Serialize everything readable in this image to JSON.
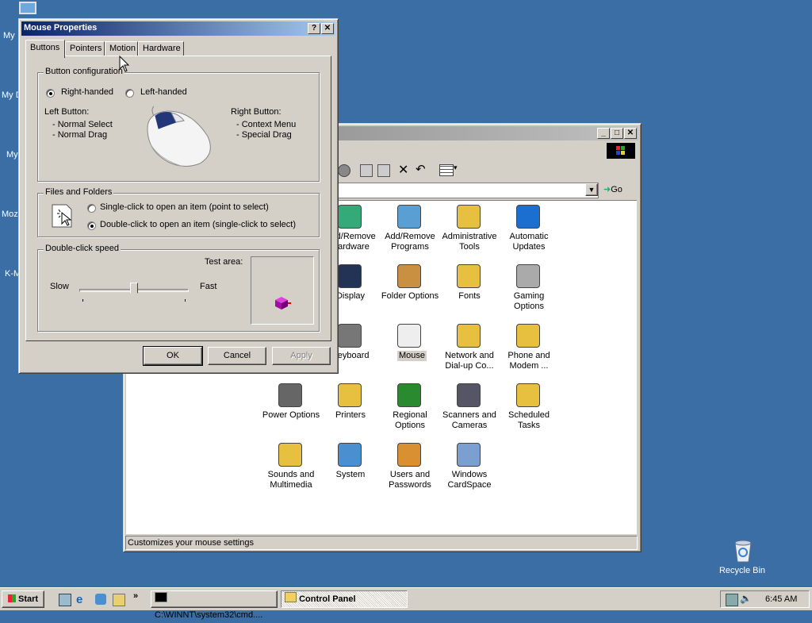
{
  "desktop": {
    "left_labels": [
      "My",
      "My D",
      "My",
      "Moz",
      "K-M"
    ],
    "recycle_bin": "Recycle Bin"
  },
  "mouse_dialog": {
    "title": "Mouse Properties",
    "help_btn": "?",
    "close_btn": "✕",
    "tabs": [
      "Buttons",
      "Pointers",
      "Motion",
      "Hardware"
    ],
    "active_tab": "Buttons",
    "button_config": {
      "legend": "Button configuration",
      "right_handed": "Right-handed",
      "left_handed": "Left-handed",
      "selected": "Right-handed",
      "left_button_title": "Left Button:",
      "left_button_items": [
        "- Normal Select",
        "- Normal Drag"
      ],
      "right_button_title": "Right Button:",
      "right_button_items": [
        "- Context Menu",
        "- Special Drag"
      ]
    },
    "files_folders": {
      "legend": "Files and Folders",
      "single_click": "Single-click to open an item (point to select)",
      "double_click": "Double-click to open an item (single-click to select)",
      "selected": "double"
    },
    "double_click_speed": {
      "legend": "Double-click speed",
      "test_area": "Test area:",
      "slow": "Slow",
      "fast": "Fast",
      "slider_value": 0.5
    },
    "buttons": {
      "ok": "OK",
      "cancel": "Cancel",
      "apply": "Apply"
    }
  },
  "control_panel": {
    "title": "Control Panel",
    "go_label": "Go",
    "status": "Customizes your mouse settings",
    "icons": [
      {
        "label": "Add/Remove\nHardware",
        "icon": "hardware-icon"
      },
      {
        "label": "Add/Remove\nPrograms",
        "icon": "programs-icon"
      },
      {
        "label": "Administrative\nTools",
        "icon": "admin-tools-icon"
      },
      {
        "label": "Automatic\nUpdates",
        "icon": "updates-icon"
      },
      {
        "label": "Display",
        "icon": "display-icon"
      },
      {
        "label": "Folder Options",
        "icon": "folder-options-icon"
      },
      {
        "label": "Fonts",
        "icon": "fonts-icon"
      },
      {
        "label": "Gaming\nOptions",
        "icon": "gaming-icon"
      },
      {
        "label": "Keyboard",
        "icon": "keyboard-icon"
      },
      {
        "label": "Mouse",
        "icon": "mouse-icon"
      },
      {
        "label": "Network and\nDial-up Co...",
        "icon": "network-icon"
      },
      {
        "label": "Phone and\nModem ...",
        "icon": "phone-icon"
      },
      {
        "label": "Power Options",
        "icon": "power-icon"
      },
      {
        "label": "Printers",
        "icon": "printers-icon"
      },
      {
        "label": "Regional\nOptions",
        "icon": "regional-icon"
      },
      {
        "label": "Scanners and\nCameras",
        "icon": "scanner-icon"
      },
      {
        "label": "Scheduled\nTasks",
        "icon": "tasks-icon"
      },
      {
        "label": "Sounds and\nMultimedia",
        "icon": "sounds-icon"
      },
      {
        "label": "System",
        "icon": "system-icon"
      },
      {
        "label": "Users and\nPasswords",
        "icon": "users-icon"
      },
      {
        "label": "Windows\nCardSpace",
        "icon": "cardspace-icon"
      }
    ]
  },
  "taskbar": {
    "start": "Start",
    "tasks": [
      "C:\\WINNT\\system32\\cmd....",
      "Control Panel"
    ],
    "clock": "6:45 AM"
  },
  "colors": {
    "desktop": "#3a6ea5",
    "title_active": "#0a246a",
    "face": "#d4d0c8"
  }
}
